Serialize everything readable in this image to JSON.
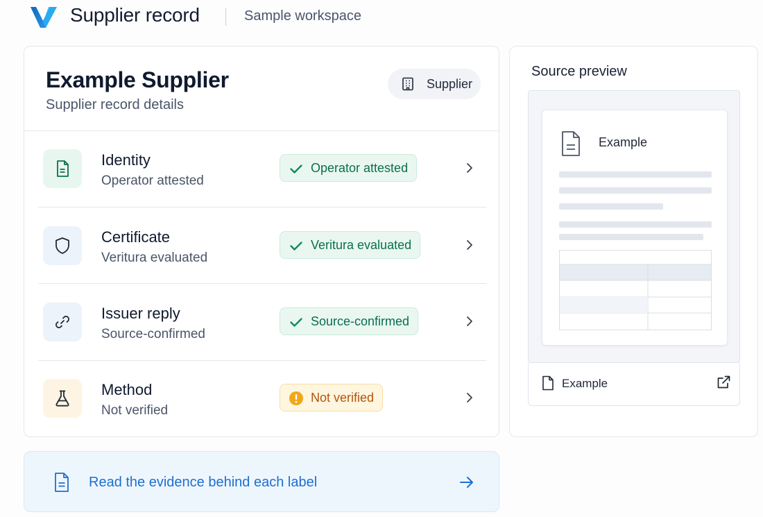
{
  "header": {
    "app_title": "Supplier record",
    "workspace": "Sample workspace",
    "logo_icon": "v-logo-icon",
    "brand_color": "#1e88e5"
  },
  "supplier": {
    "name": "Example Supplier",
    "subtitle": "Supplier record details",
    "type_chip": {
      "label": "Supplier",
      "icon": "building-icon"
    }
  },
  "rows": [
    {
      "title": "Identity",
      "subtitle": "Operator attested",
      "badge": "Operator attested",
      "status": "verified",
      "icon": "document-icon"
    },
    {
      "title": "Certificate",
      "subtitle": "Veritura evaluated",
      "badge": "Veritura evaluated",
      "status": "verified",
      "icon": "shield-icon"
    },
    {
      "title": "Issuer reply",
      "subtitle": "Source-confirmed",
      "badge": "Source-confirmed",
      "status": "verified",
      "icon": "link-icon"
    },
    {
      "title": "Method",
      "subtitle": "Not verified",
      "badge": "Not verified",
      "status": "warning",
      "icon": "flask-icon"
    }
  ],
  "cta": {
    "label": "Read the evidence behind each label",
    "icon": "document-icon",
    "arrow_icon": "arrow-right-icon"
  },
  "preview": {
    "title": "Source preview",
    "document_title": "Example",
    "footer_label": "Example",
    "footer_icon": "file-icon",
    "open_icon": "external-link-icon"
  },
  "colors": {
    "verified": "#0b6e4f",
    "warning": "#b45309",
    "link": "#1d6fd1"
  }
}
